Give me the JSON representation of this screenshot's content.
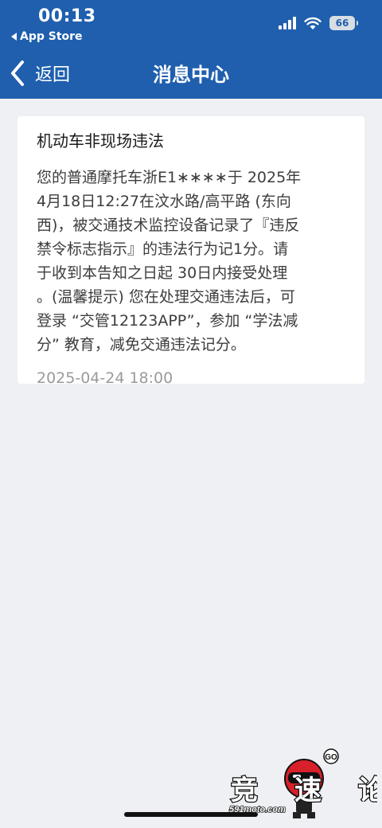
{
  "status_bar": {
    "time": "00:13",
    "back_app_label": "App Store",
    "battery": "66"
  },
  "nav": {
    "back_label": "返回",
    "title": "消息中心"
  },
  "message": {
    "title": "机动车非现场违法",
    "body_lines": [
      "您的普通摩托车浙E1∗∗∗∗于 2025年",
      "4月18日12:27在汶水路/高平路 (东向",
      "西)，被交通技术监控设备记录了『违反",
      "禁令标志指示』的违法行为记1分。请",
      "于收到本告知之日起 30日内接受处理",
      "。(温馨提示) 您在处理交通违法后，可",
      "登录 “交管12123APP”，参加 “学法减",
      "分” 教育，减免交通违法记分。"
    ],
    "timestamp": "2025-04-24 18:00"
  },
  "watermark": {
    "brand": "竞速论坛",
    "site": "591moto.com",
    "badge": "GO"
  },
  "colors": {
    "header_bg": "#1f5fae",
    "page_bg": "#eef0f3",
    "card_bg": "#ffffff",
    "timestamp": "#9a9a9a"
  },
  "icons": {
    "back": "chevron-left-icon",
    "signal": "cellular-signal-icon",
    "wifi": "wifi-icon",
    "battery": "battery-icon"
  }
}
